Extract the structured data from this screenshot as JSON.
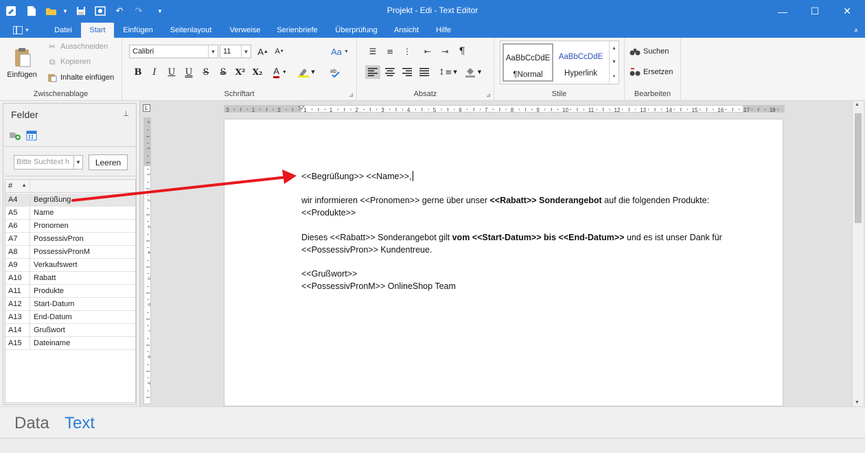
{
  "window": {
    "title": "Projekt - Edi - Text Editor"
  },
  "ribbon_tabs": [
    "Datei",
    "Start",
    "Einfügen",
    "Seitenlayout",
    "Verweise",
    "Serienbriefe",
    "Überprüfung",
    "Ansicht",
    "Hilfe"
  ],
  "active_tab": "Start",
  "clipboard": {
    "paste": "Einfügen",
    "cut": "Ausschneiden",
    "copy": "Kopieren",
    "paste_special": "Inhalte einfügen",
    "label": "Zwischenablage"
  },
  "font": {
    "family": "Calibri",
    "size": "11",
    "label": "Schriftart",
    "grow": "A",
    "shrink": "A",
    "case": "Aa",
    "bold": "B",
    "italic": "I",
    "underline": "U",
    "double_underline": "U",
    "strike": "S",
    "double_strike": "S",
    "superscript": "X²",
    "subscript": "X₂",
    "font_color": "A"
  },
  "paragraph": {
    "label": "Absatz",
    "pilcrow": "¶"
  },
  "styles": {
    "label": "Stile",
    "items": [
      {
        "sample": "AaBbCcDdE",
        "name": "¶Normal"
      },
      {
        "sample": "AaBbCcDdE",
        "name": "Hyperlink"
      }
    ],
    "hyperlink_color": "#2a4fb8"
  },
  "editing": {
    "find": "Suchen",
    "replace": "Ersetzen",
    "label": "Bearbeiten"
  },
  "fields_panel": {
    "title": "Felder",
    "search_placeholder": "Bitte Suchtext h",
    "clear_button": "Leeren",
    "col_header": "#",
    "rows": [
      {
        "id": "A4",
        "name": "Begrüßung"
      },
      {
        "id": "A5",
        "name": "Name"
      },
      {
        "id": "A6",
        "name": "Pronomen"
      },
      {
        "id": "A7",
        "name": "PossessivPron"
      },
      {
        "id": "A8",
        "name": "PossessivPronM"
      },
      {
        "id": "A9",
        "name": "Verkaufswert"
      },
      {
        "id": "A10",
        "name": "Rabatt"
      },
      {
        "id": "A11",
        "name": "Produkte"
      },
      {
        "id": "A12",
        "name": "Start-Datum"
      },
      {
        "id": "A13",
        "name": "End-Datum"
      },
      {
        "id": "A14",
        "name": "Grußwort"
      },
      {
        "id": "A15",
        "name": "Dateiname"
      }
    ]
  },
  "document": {
    "line1": "<<Begrüßung>> <<Name>>,",
    "p1_a": "wir informieren <<Pronomen>> gerne über unser ",
    "p1_b": "<<Rabatt>> Sonderangebot",
    "p1_c": " auf die folgenden Produkte:",
    "p1_line2": "<<Produkte>>",
    "p2_a": "Dieses <<Rabatt>> Sonderangebot gilt ",
    "p2_b": "vom <<Start-Datum>> bis <<End-Datum>>",
    "p2_c": " und es ist unser Dank für",
    "p2_line2": "<<PossessivPron>> Kundentreue.",
    "closing1": "<<Grußwort>>",
    "closing2": "<<PossessivPronM>> OnlineShop Team"
  },
  "bottom_tabs": {
    "data": "Data",
    "text": "Text"
  },
  "colors": {
    "titlebar": "#2b7bd6",
    "accent_text": "#2b7bd6",
    "arrow": "#e8171c"
  },
  "ruler_numbers": [
    "3",
    "1",
    "2",
    "1",
    "1",
    "2",
    "3",
    "4",
    "5",
    "6",
    "7",
    "8",
    "9",
    "10",
    "11",
    "12",
    "13",
    "14",
    "15",
    "16",
    "17",
    "18"
  ],
  "vruler_numbers": [
    "2",
    "1",
    "1",
    "2",
    "3",
    "4",
    "5",
    "6",
    "7",
    "8",
    "9"
  ]
}
